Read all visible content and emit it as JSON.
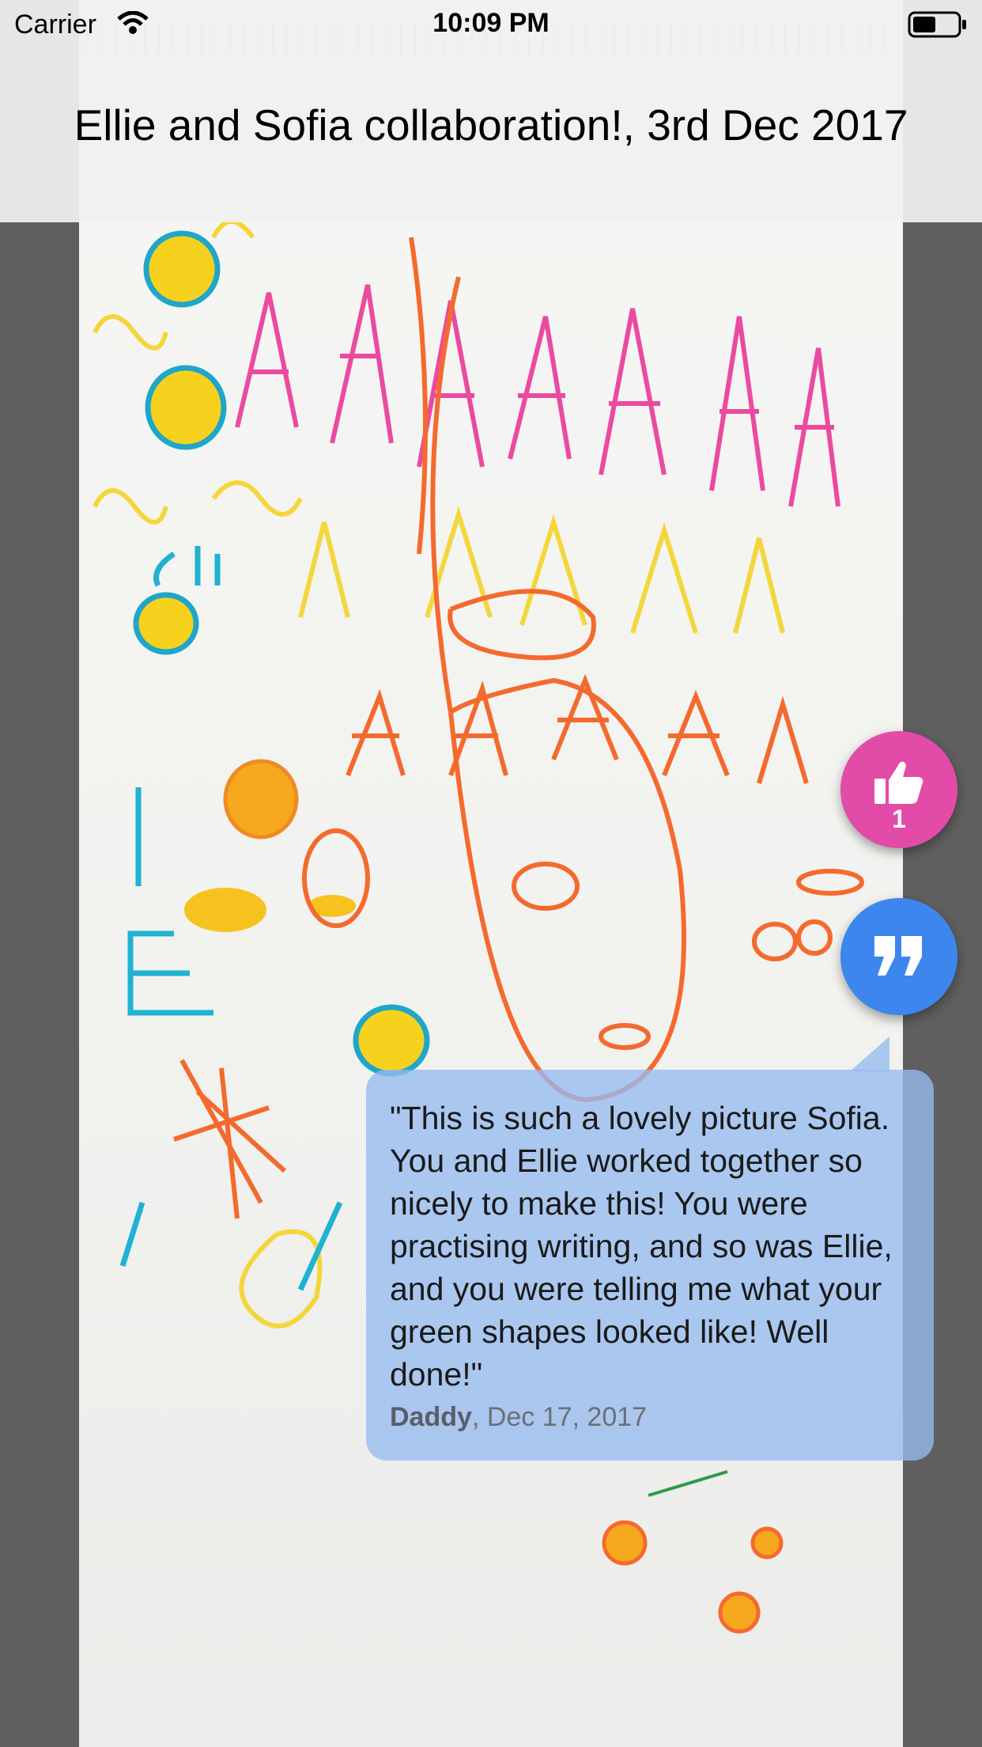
{
  "status_bar": {
    "carrier": "Carrier",
    "time": "10:09 PM"
  },
  "header": {
    "title": "Ellie and Sofia collaboration!, 3rd Dec 2017"
  },
  "actions": {
    "like_count": "1",
    "like_icon": "thumbs-up-icon",
    "comment_icon": "quote-icon",
    "like_color": "#e34ba8",
    "comment_color": "#3d86ee"
  },
  "comment": {
    "text": "\"This is such a lovely picture Sofia. You and Ellie worked together so nicely to make this! You were practising writing, and so was Ellie, and you were telling me what your green shapes looked like! Well done!\"",
    "author": "Daddy",
    "date": ", Dec 17, 2017"
  }
}
